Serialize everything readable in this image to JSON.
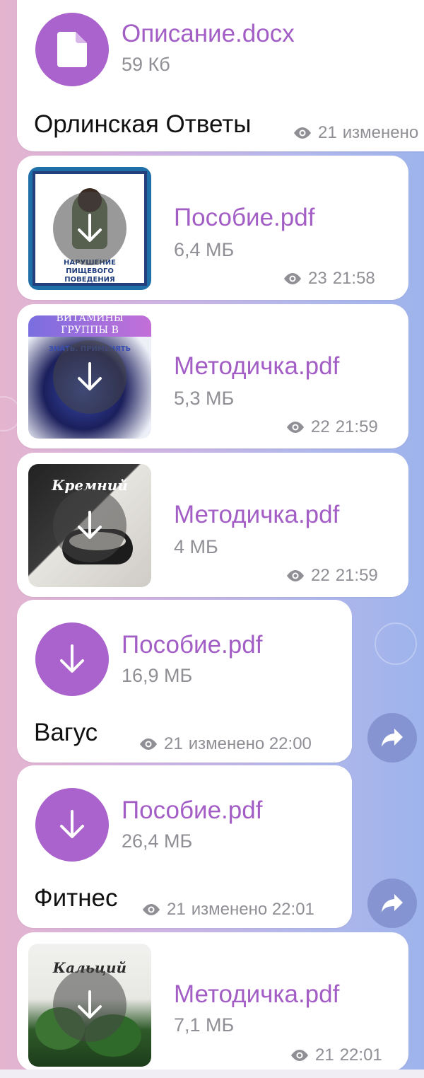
{
  "messages": [
    {
      "file_name": "Описание.docx",
      "file_size": "59 Кб",
      "caption": "Орлинская Ответы",
      "views": "21",
      "time_text": "изменено",
      "icon": "document-icon"
    },
    {
      "file_name": "Пособие.pdf",
      "file_size": "6,4 МБ",
      "views": "23",
      "time_text": "21:58",
      "thumb_title": "НАРУШЕНИЕ ПИЩЕВОГО ПОВЕДЕНИЯ"
    },
    {
      "file_name": "Методичка.pdf",
      "file_size": "5,3 МБ",
      "views": "22",
      "time_text": "21:59",
      "thumb_title": "ВИТАМИНЫ ГРУППЫ В",
      "thumb_subtitle": "ЗНАТЬ. ПРИМЕНЯТЬ"
    },
    {
      "file_name": "Методичка.pdf",
      "file_size": "4 МБ",
      "views": "22",
      "time_text": "21:59",
      "thumb_title": "Кремний"
    },
    {
      "file_name": "Пособие.pdf",
      "file_size": "16,9 МБ",
      "caption": "Вагус",
      "views": "21",
      "time_text": "изменено 22:00"
    },
    {
      "file_name": "Пособие.pdf",
      "file_size": "26,4 МБ",
      "caption": "Фитнес",
      "views": "21",
      "time_text": "изменено 22:01"
    },
    {
      "file_name": "Методичка.pdf",
      "file_size": "7,1 МБ",
      "views": "21",
      "time_text": "22:01",
      "thumb_title": "Кальций"
    }
  ],
  "colors": {
    "accent": "#aa63cc",
    "file_name": "#a35ec6",
    "meta": "#8f8f95"
  }
}
